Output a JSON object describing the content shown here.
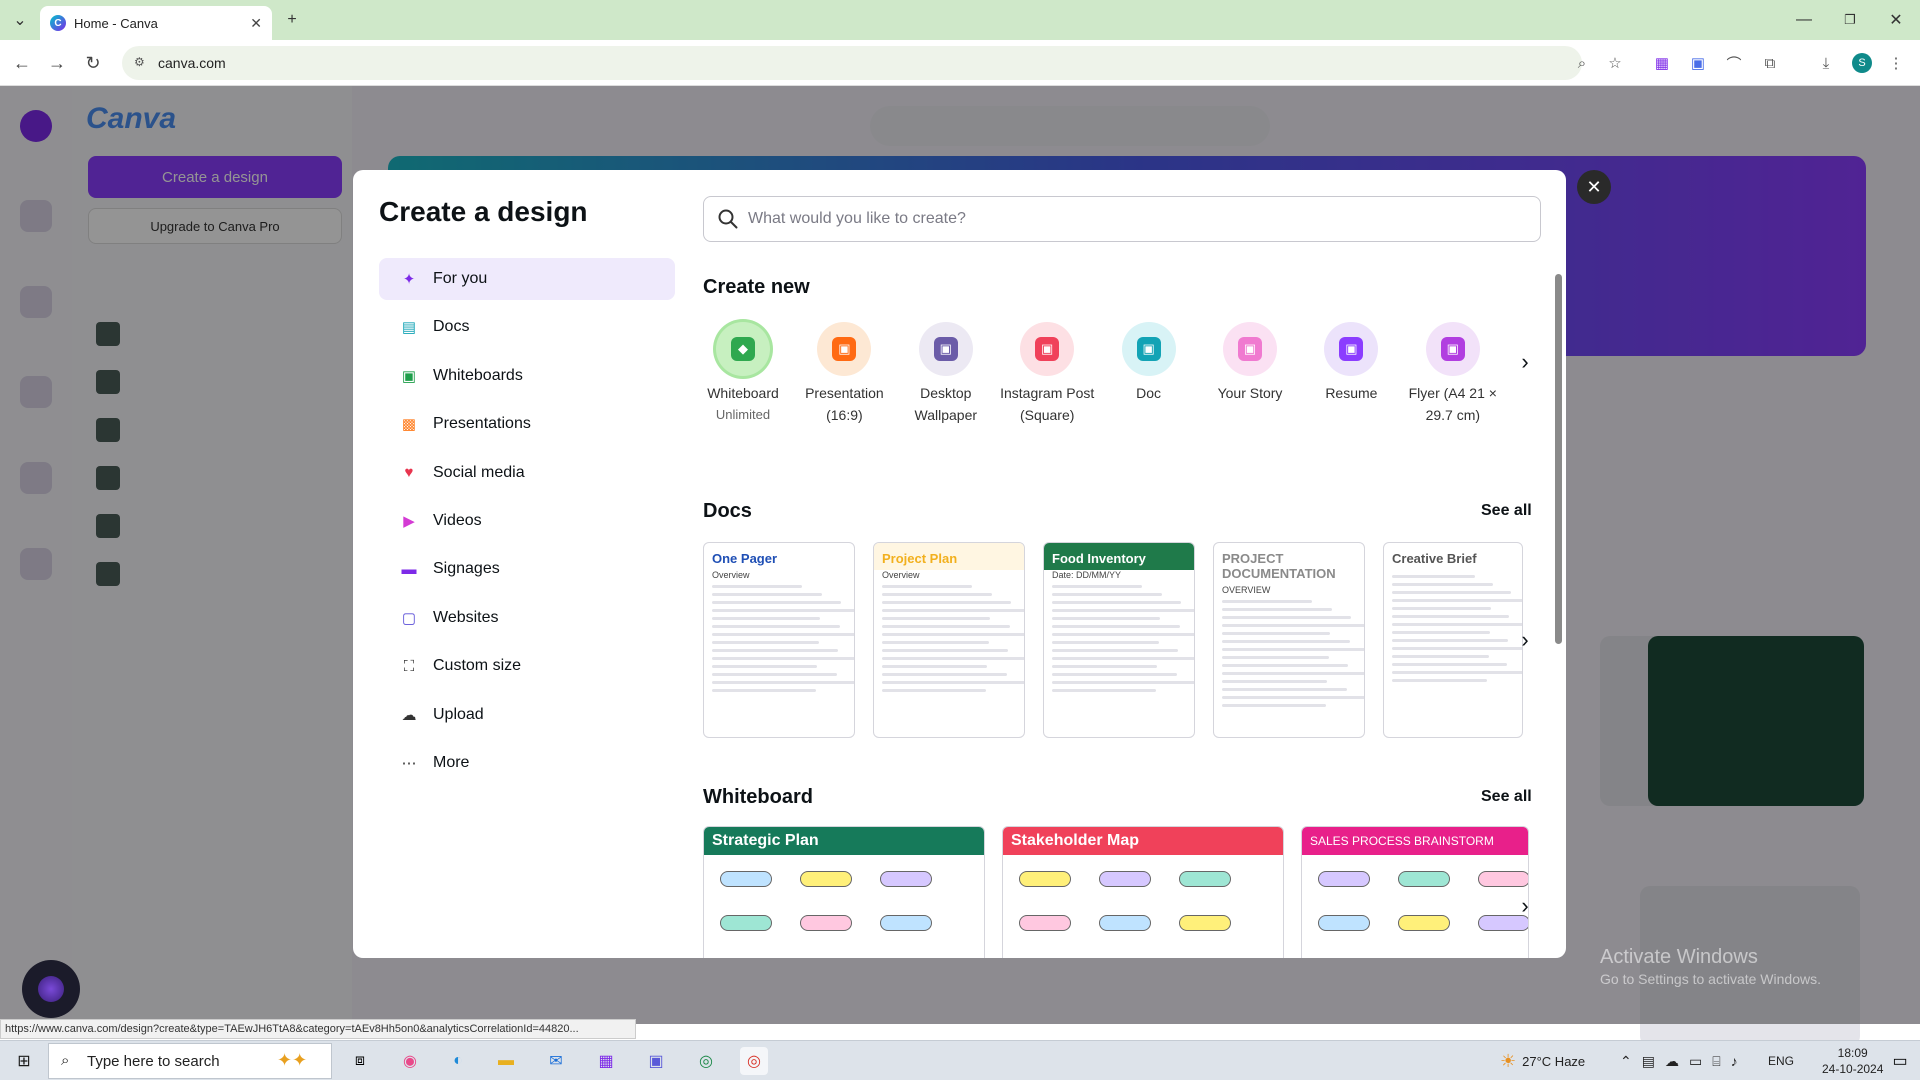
{
  "browser": {
    "tab_title": "Home - Canva",
    "tab_favicon": "C",
    "url": "canva.com",
    "status_url": "https://www.canva.com/design?create&type=TAEwJH6TtA8&category=tAEv8Hh5on0&analyticsCorrelationId=44820...",
    "profile_initial": "S"
  },
  "modal": {
    "title": "Create a design",
    "search_placeholder": "What would you like to create?",
    "categories": [
      {
        "label": "For you",
        "icon": "sparkle-icon",
        "color": "#7d2ae8"
      },
      {
        "label": "Docs",
        "icon": "doc-icon",
        "color": "#13a3b5"
      },
      {
        "label": "Whiteboards",
        "icon": "whiteboard-icon",
        "color": "#1e9e4a"
      },
      {
        "label": "Presentations",
        "icon": "presentation-icon",
        "color": "#ff7a1a"
      },
      {
        "label": "Social media",
        "icon": "heart-icon",
        "color": "#e8344e"
      },
      {
        "label": "Videos",
        "icon": "video-icon",
        "color": "#d43bd4"
      },
      {
        "label": "Signages",
        "icon": "signage-icon",
        "color": "#7d2ae8"
      },
      {
        "label": "Websites",
        "icon": "website-icon",
        "color": "#5a4ed8"
      },
      {
        "label": "Custom size",
        "icon": "crop-icon",
        "color": "#333333"
      },
      {
        "label": "Upload",
        "icon": "upload-icon",
        "color": "#333333"
      },
      {
        "label": "More",
        "icon": "more-icon",
        "color": "#333333"
      }
    ],
    "create_new": {
      "title": "Create new",
      "items": [
        {
          "label": "Whiteboard",
          "sub": "Unlimited",
          "bg": "#c7f0c0",
          "fg": "#2fa84f"
        },
        {
          "label": "Presentation (16:9)",
          "sub": "",
          "bg": "#fde8d4",
          "fg": "#ff6a13"
        },
        {
          "label": "Desktop Wallpaper",
          "sub": "",
          "bg": "#ece9f3",
          "fg": "#6b5ca8"
        },
        {
          "label": "Instagram Post (Square)",
          "sub": "",
          "bg": "#fde0e4",
          "fg": "#f0415a"
        },
        {
          "label": "Doc",
          "sub": "",
          "bg": "#d8f3f6",
          "fg": "#13a3b5"
        },
        {
          "label": "Your Story",
          "sub": "",
          "bg": "#fbe1f3",
          "fg": "#f07ad0"
        },
        {
          "label": "Resume",
          "sub": "",
          "bg": "#ece3fb",
          "fg": "#8b3dff"
        },
        {
          "label": "Flyer (A4 21 × 29.7 cm)",
          "sub": "",
          "bg": "#f2e2f9",
          "fg": "#b13ee0"
        }
      ]
    },
    "docs": {
      "title": "Docs",
      "see_all": "See all",
      "items": [
        {
          "title": "One Pager",
          "accent": "#1f4fb5",
          "sub": "Overview"
        },
        {
          "title": "Project Plan",
          "accent": "#f2b01e",
          "sub": "Overview"
        },
        {
          "title": "Food Inventory",
          "accent": "#1f7a4a",
          "sub": "Date: DD/MM/YY"
        },
        {
          "title": "PROJECT DOCUMENTATION",
          "accent": "#8a8a8a",
          "sub": "OVERVIEW"
        },
        {
          "title": "Creative Brief",
          "accent": "#555555",
          "sub": ""
        }
      ]
    },
    "whiteboard": {
      "title": "Whiteboard",
      "see_all": "See all",
      "items": [
        {
          "title": "Strategic Plan",
          "color": "#167a5a"
        },
        {
          "title": "Stakeholder Map",
          "color": "#f0415a"
        },
        {
          "title": "SALES PROCESS BRAINSTORM",
          "color": "#e8208a"
        }
      ]
    }
  },
  "background": {
    "create_button": "Create a design",
    "upgrade_button": "Upgrade to Canva Pro"
  },
  "watermark": {
    "line1": "Activate Windows",
    "line2": "Go to Settings to activate Windows."
  },
  "taskbar": {
    "search_placeholder": "Type here to search",
    "weather": "27°C  Haze",
    "language": "ENG",
    "time": "18:09",
    "date": "24-10-2024"
  }
}
